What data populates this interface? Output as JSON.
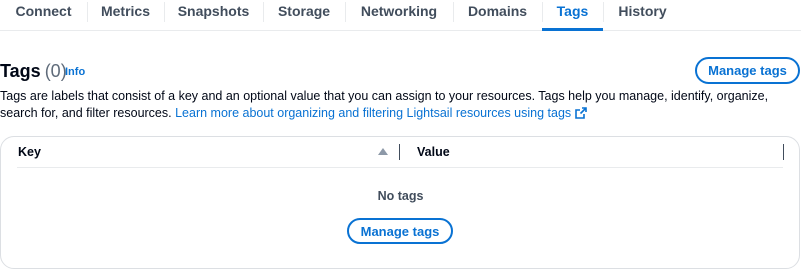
{
  "tabs": [
    {
      "label": "Connect",
      "active": false
    },
    {
      "label": "Metrics",
      "active": false
    },
    {
      "label": "Snapshots",
      "active": false
    },
    {
      "label": "Storage",
      "active": false
    },
    {
      "label": "Networking",
      "active": false
    },
    {
      "label": "Domains",
      "active": false
    },
    {
      "label": "Tags",
      "active": true
    },
    {
      "label": "History",
      "active": false
    }
  ],
  "header": {
    "title": "Tags",
    "count": "(0)",
    "info_link": "Info",
    "manage_button": "Manage tags"
  },
  "description": {
    "text": "Tags are labels that consist of a key and an optional value that you can assign to your resources. Tags help you manage, identify, organize, search for, and filter resources.",
    "link": "Learn more about organizing and filtering Lightsail resources using tags",
    "link_icon": "external-link-icon"
  },
  "table": {
    "columns": [
      "Key",
      "Value"
    ],
    "sort_icon": "sort-ascending-icon",
    "empty_text": "No tags",
    "empty_button": "Manage tags"
  },
  "colors": {
    "accent": "#0972d3",
    "text": "#000716",
    "muted": "#5f6b7a",
    "border": "#dcdfe3"
  }
}
